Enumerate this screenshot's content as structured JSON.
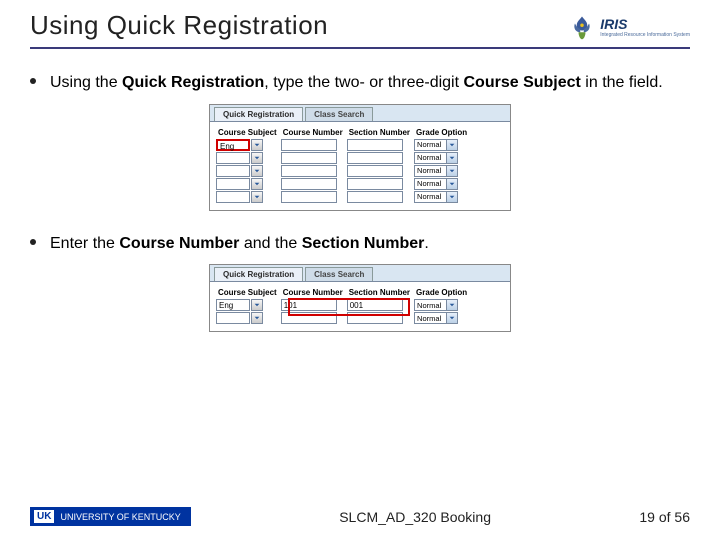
{
  "header": {
    "title": "Using Quick Registration",
    "logo_text": "IRIS",
    "logo_sub": "Integrated Resource Information System"
  },
  "bullets": {
    "b1_part1": "Using the ",
    "b1_bold1": "Quick Registration",
    "b1_part2": ", type the two- or three-digit ",
    "b1_bold2": "Course Subject",
    "b1_part3": " in the field.",
    "b2_part1": "Enter the ",
    "b2_bold1": "Course Number",
    "b2_part2": " and the ",
    "b2_bold2": "Section Number",
    "b2_part3": "."
  },
  "shot": {
    "tab_quick": "Quick Registration",
    "tab_class": "Class Search",
    "head_subject": "Course Subject",
    "head_number": "Course Number",
    "head_section": "Section Number",
    "head_grade": "Grade Option",
    "grade_normal": "Normal",
    "val_eng": "Eng",
    "val_101": "101",
    "val_001": "001"
  },
  "footer": {
    "uk_short": "UK",
    "uk_text": "UNIVERSITY OF KENTUCKY",
    "center": "SLCM_AD_320 Booking",
    "page": "19 of 56"
  }
}
